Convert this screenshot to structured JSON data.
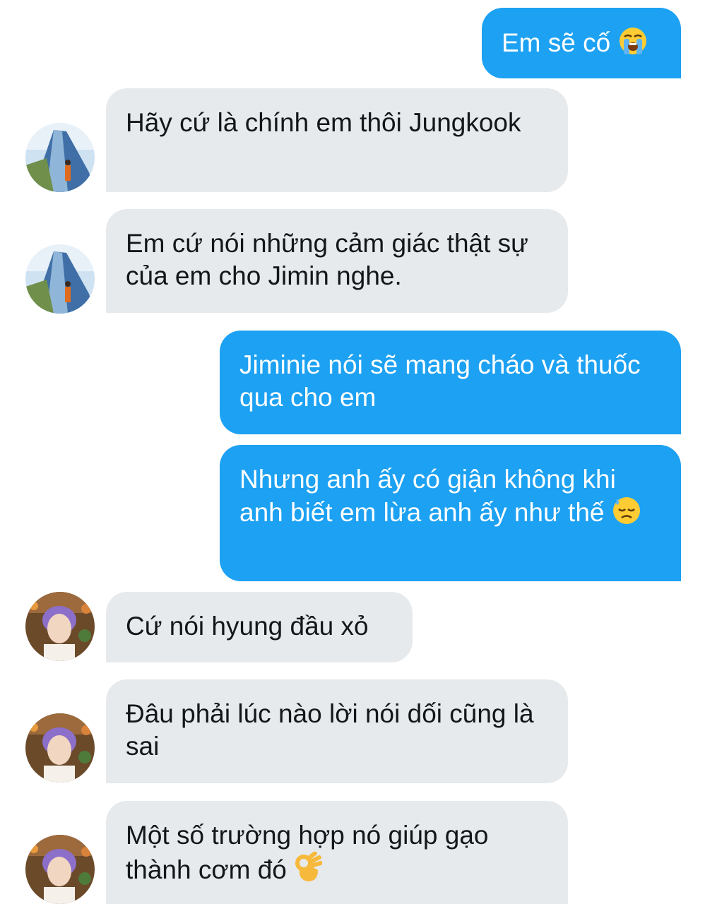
{
  "messages": [
    {
      "side": "sent",
      "text": "Em sẽ cố",
      "emoji": "loudly-crying-face"
    },
    {
      "side": "received",
      "text": "Hãy cứ là chính em thôi Jungkook"
    },
    {
      "side": "received",
      "text": "Em cứ nói những cảm giác thật sự của em cho Jimin nghe."
    },
    {
      "side": "sent",
      "text": "Jiminie nói sẽ mang cháo và thuốc qua cho em"
    },
    {
      "side": "sent",
      "text": "Nhưng anh ấy có giận không khi anh biết em lừa anh ấy như thế",
      "emoji": "downcast-face-with-sweat"
    },
    {
      "side": "received",
      "text": "Cứ nói hyung đầu xỏ"
    },
    {
      "side": "received",
      "text": "Đâu phải lúc nào lời nói dối cũng là sai"
    },
    {
      "side": "received",
      "text": "Một số trường hợp nó giúp gạo thành cơm đó",
      "emoji": "ok-hand"
    }
  ],
  "colors": {
    "sent_bubble": "#1da1f2",
    "received_bubble": "#e7eaed",
    "sent_text": "#ffffff",
    "received_text": "#14171a"
  }
}
